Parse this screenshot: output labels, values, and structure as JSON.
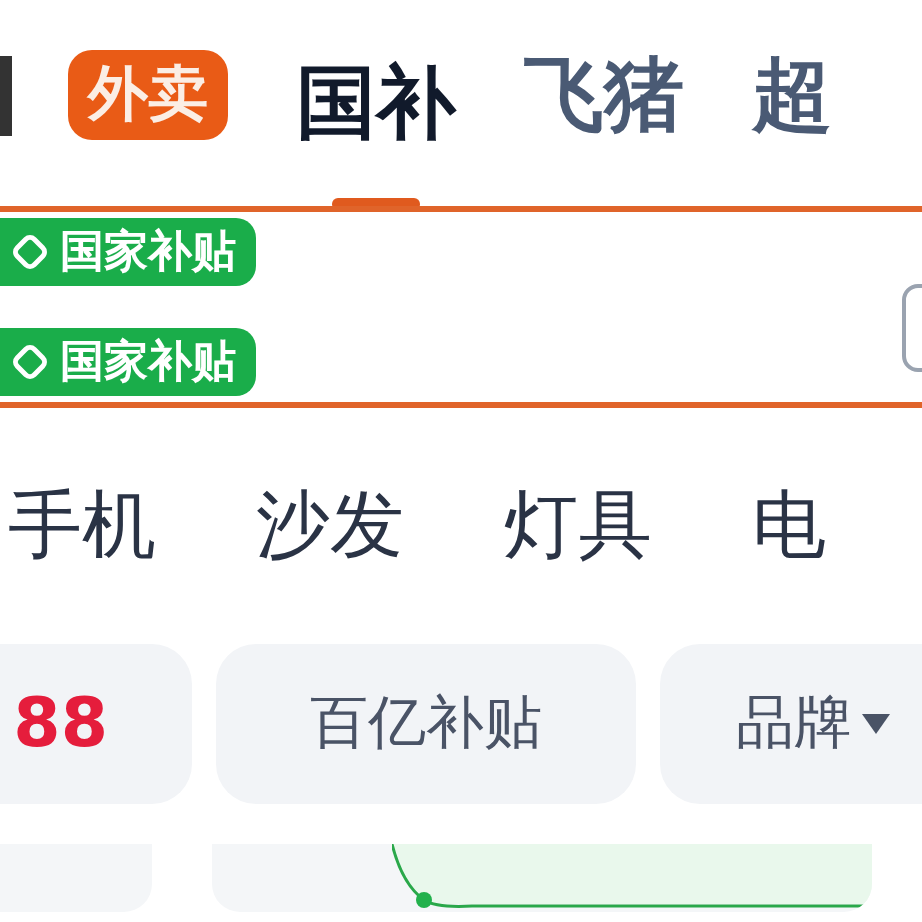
{
  "top_tabs": [
    {
      "label": "外卖",
      "kind": "badge",
      "selected": false
    },
    {
      "label": "国补",
      "kind": "plain",
      "selected": true
    },
    {
      "label": "飞猪",
      "kind": "plain",
      "selected": false
    },
    {
      "label": "超",
      "kind": "plain",
      "selected": false
    }
  ],
  "subsidy_badges": [
    "国家补贴",
    "国家补贴"
  ],
  "categories": [
    "手机",
    "沙发",
    "灯具",
    "电"
  ],
  "filters": [
    {
      "label": "88",
      "kind": "price"
    },
    {
      "label": "百亿补贴",
      "kind": "plain"
    },
    {
      "label": "品牌",
      "kind": "dropdown"
    }
  ]
}
